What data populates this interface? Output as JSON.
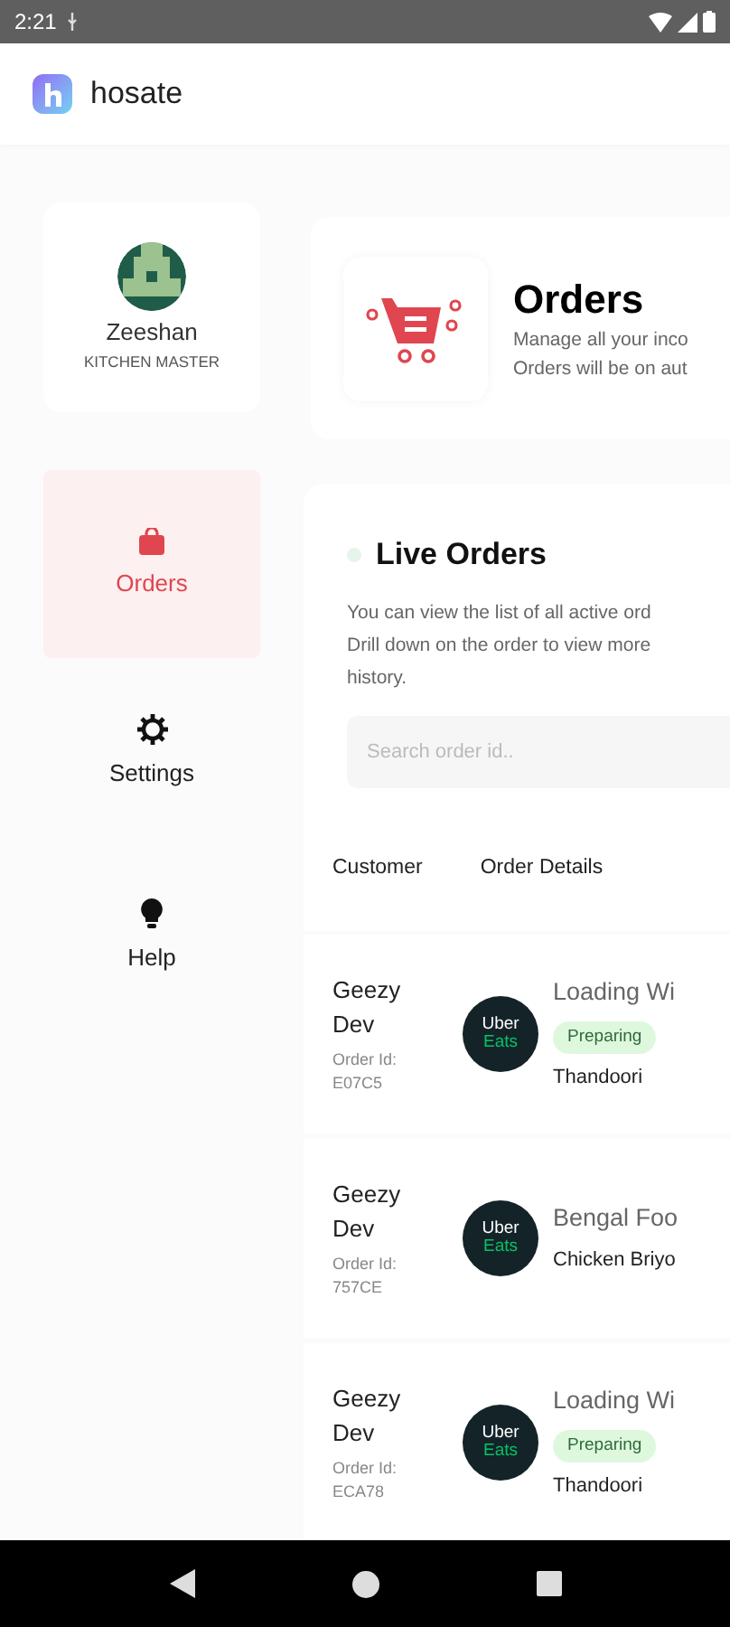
{
  "status_bar": {
    "time": "2:21"
  },
  "app_bar": {
    "title": "hosate"
  },
  "profile": {
    "name": "Zeeshan",
    "role": "KITCHEN MASTER"
  },
  "nav": [
    {
      "kind": "orders",
      "label": "Orders",
      "selected": true
    },
    {
      "kind": "settings",
      "label": "Settings",
      "selected": false
    },
    {
      "kind": "help",
      "label": "Help",
      "selected": false
    }
  ],
  "header": {
    "title": "Orders",
    "description": [
      "Manage all your inco",
      "Orders will be on aut"
    ]
  },
  "live_orders": {
    "title": "Live Orders",
    "description": [
      "You can view the list of all active ord",
      "Drill down on the order to view more",
      "history."
    ],
    "search": {
      "placeholder": "Search order id.."
    },
    "columns": [
      "Customer",
      "Order Details"
    ]
  },
  "orders": [
    {
      "customer": "Geezy Dev",
      "order_id_label": "Order Id:",
      "order_id": "E07C5",
      "logo": [
        "Uber",
        "Eats"
      ],
      "restaurant": "Loading Wi",
      "status": "Preparing",
      "item": "Thandoori"
    },
    {
      "customer": "Geezy Dev",
      "order_id_label": "Order Id:",
      "order_id": "757CE",
      "logo": [
        "Uber",
        "Eats"
      ],
      "restaurant": "Bengal Foo",
      "item": "Chicken Briyo"
    },
    {
      "customer": "Geezy Dev",
      "order_id_label": "Order Id:",
      "order_id": "ECA78",
      "logo": [
        "Uber",
        "Eats"
      ],
      "restaurant": "Loading Wi",
      "status": "Preparing",
      "item": "Thandoori"
    }
  ]
}
